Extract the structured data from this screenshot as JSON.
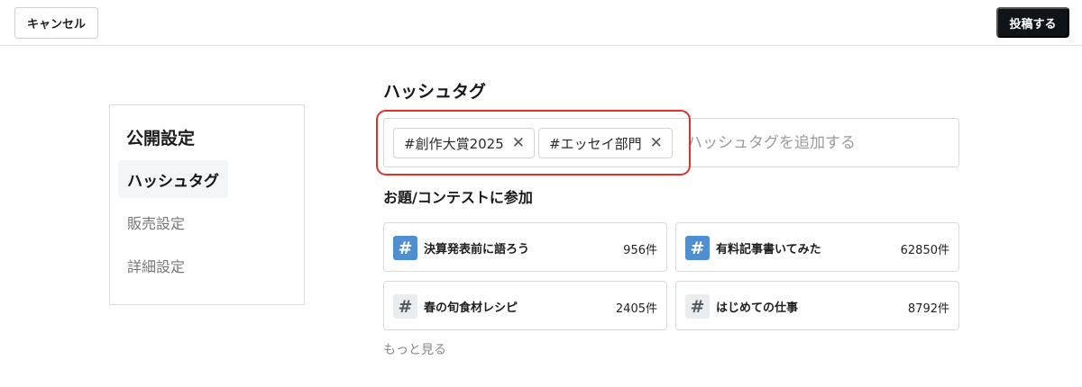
{
  "header": {
    "cancel_label": "キャンセル",
    "post_label": "投稿する"
  },
  "sidebar": {
    "title": "公開設定",
    "items": [
      {
        "label": "ハッシュタグ",
        "active": true
      },
      {
        "label": "販売設定",
        "active": false
      },
      {
        "label": "詳細設定",
        "active": false
      }
    ]
  },
  "hashtag_section": {
    "title": "ハッシュタグ",
    "tags": [
      {
        "label": "#創作大賞2025"
      },
      {
        "label": "#エッセイ部門"
      }
    ],
    "remove_glyph": "✕",
    "input_placeholder": "ハッシュタグを追加する",
    "highlight_color": "#e0312b"
  },
  "contest_section": {
    "title": "お題/コンテストに参加",
    "hash_glyph": "#",
    "items": [
      {
        "name": "決算発表前に語ろう",
        "count": "956件",
        "icon": "hash-blue-icon"
      },
      {
        "name": "有料記事書いてみた",
        "count": "62850件",
        "icon": "hash-blue-icon"
      },
      {
        "name": "春の旬食材レシピ",
        "count": "2405件",
        "icon": "hash-gray-icon"
      },
      {
        "name": "はじめての仕事",
        "count": "8792件",
        "icon": "hash-gray-icon"
      }
    ],
    "more_label": "もっと見る"
  },
  "colors": {
    "primary_dark": "#0f1419",
    "hash_blue": "#4f8fd0",
    "hash_gray_bg": "#eaedf0",
    "highlight_red": "#e0312b"
  }
}
